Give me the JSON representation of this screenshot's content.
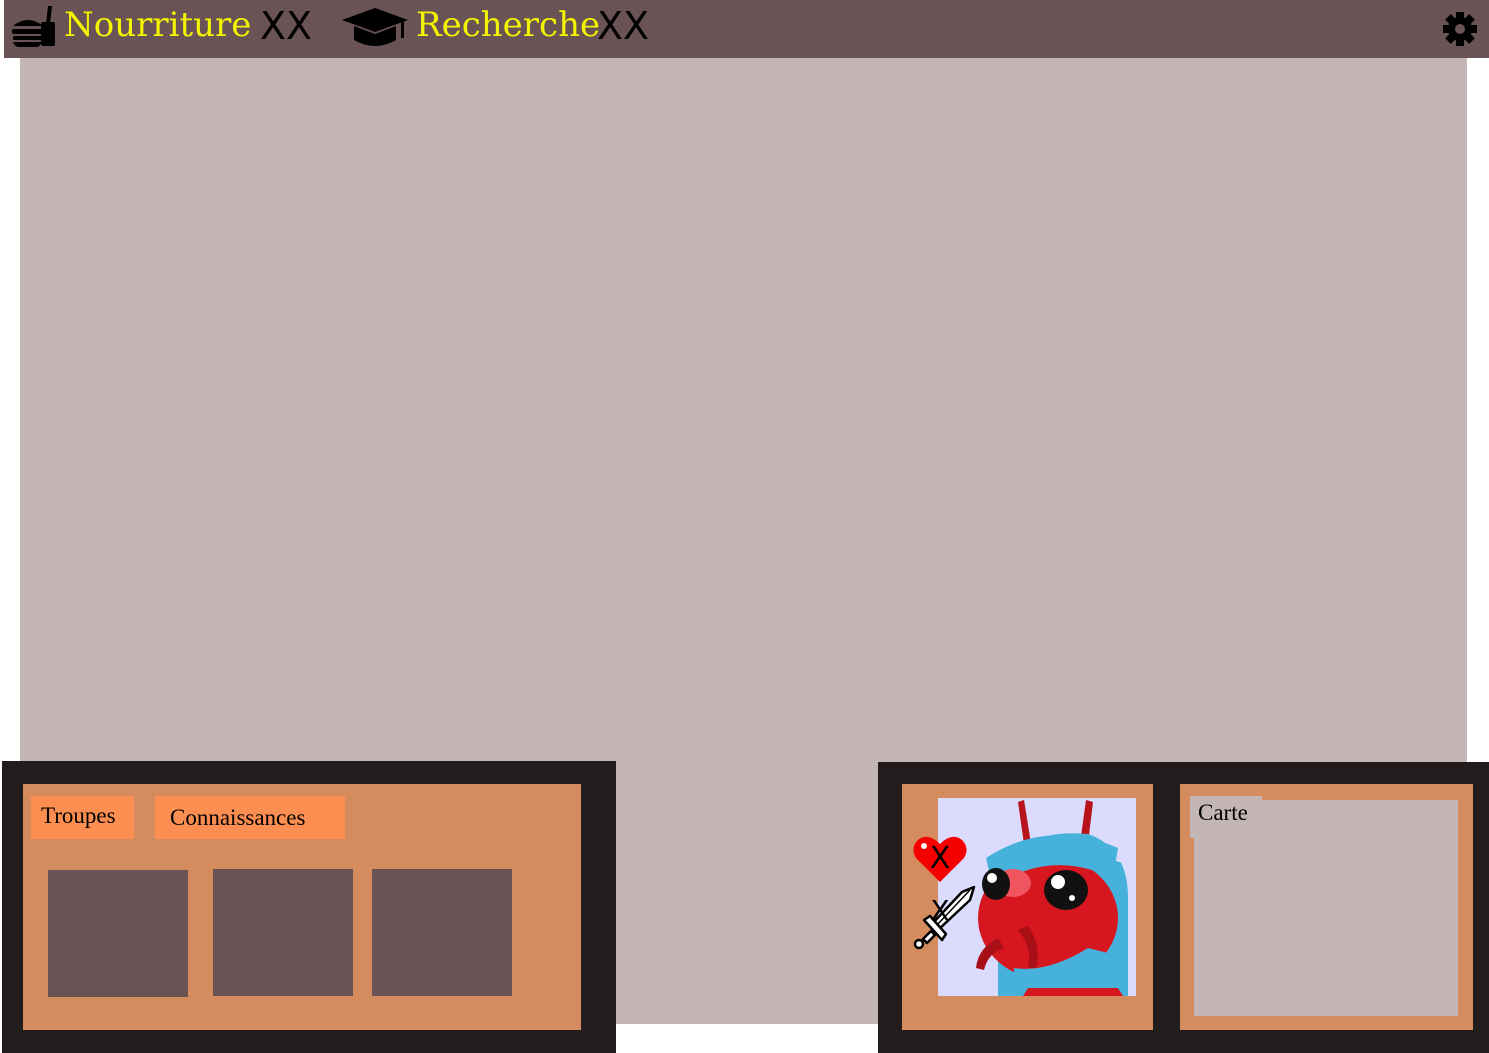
{
  "topbar": {
    "food": {
      "icon": "food-burger-drink-icon",
      "label": "Nourriture",
      "value": "XX"
    },
    "research": {
      "icon": "graduation-cap-icon",
      "label": "Recherche",
      "value": "XX"
    },
    "settings_icon": "gear-icon"
  },
  "left_panel": {
    "tabs": [
      {
        "label": "Troupes"
      },
      {
        "label": "Connaissances"
      }
    ],
    "slots": [
      "",
      "",
      ""
    ]
  },
  "unit_panel": {
    "portrait": "red-ant-soldier-portrait",
    "health": {
      "icon": "heart-icon",
      "value": "X"
    },
    "attack": {
      "icon": "sword-icon",
      "value": "X"
    }
  },
  "map_panel": {
    "tab_label": "Carte"
  },
  "colors": {
    "topbar": "#6a5354",
    "viewport": "#c5b6b6",
    "panel_frame": "#231c1d",
    "panel_inner": "#d48c5f",
    "tab": "#fc8e51",
    "slot": "#6a5354",
    "resource_label": "#f4f400"
  }
}
